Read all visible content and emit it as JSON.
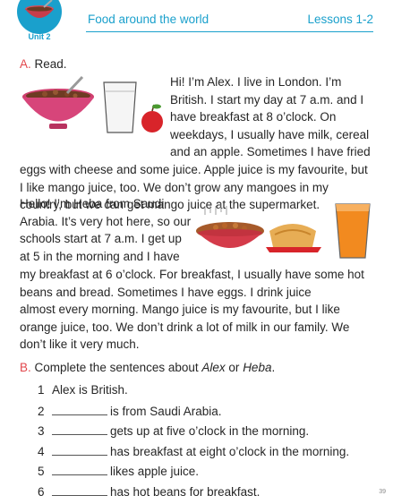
{
  "header": {
    "unit_label": "Unit 2",
    "title": "Food around the world",
    "lessons": "Lessons 1-2"
  },
  "section_a": {
    "letter": "A.",
    "instruction": "Read.",
    "alex_lines": [
      "Hi! I’m Alex. I live in London. I’m",
      "British. I start my day at 7 a.m. and I",
      "have breakfast at 8 o’clock. On",
      "weekdays, I usually have milk, cereal",
      "and an apple. Sometimes I have fried",
      "eggs with cheese and some juice. Apple juice is my favourite, but",
      "I like mango juice, too. We don’t grow any mangoes in my",
      "country, but we can get mango juice at the supermarket."
    ],
    "heba_lines": [
      "Hello! I’m Heba from Saudi",
      "Arabia. It’s very hot here, so our",
      "schools start at 7 a.m. I get up",
      "at 5 in the morning and I have",
      "my breakfast at 6 o’clock. For breakfast, I usually have some hot",
      "beans and bread. Sometimes I have eggs. I drink juice",
      "almost every morning. Mango juice is my favourite, but I like",
      "orange juice, too. We don’t drink a lot of milk in our family. We",
      "don’t like it very much."
    ]
  },
  "section_b": {
    "letter": "B.",
    "instruction_pre": "Complete the sentences about ",
    "name1": "Alex",
    "instruction_mid": " or ",
    "name2": "Heba",
    "instruction_post": ".",
    "items": [
      {
        "num": "1",
        "text": "Alex is British.",
        "blank": false
      },
      {
        "num": "2",
        "text": "is from Saudi Arabia.",
        "blank": true
      },
      {
        "num": "3",
        "text": "gets up at five o’clock in the morning.",
        "blank": true
      },
      {
        "num": "4",
        "text": "has breakfast at eight o’clock in the morning.",
        "blank": true
      },
      {
        "num": "5",
        "text": "likes apple juice.",
        "blank": true
      },
      {
        "num": "6",
        "text": "has hot beans for breakfast.",
        "blank": true
      }
    ]
  },
  "page_number": "39",
  "colors": {
    "accent": "#1aa0cc",
    "section_letter": "#e2474c",
    "text": "#262626"
  }
}
